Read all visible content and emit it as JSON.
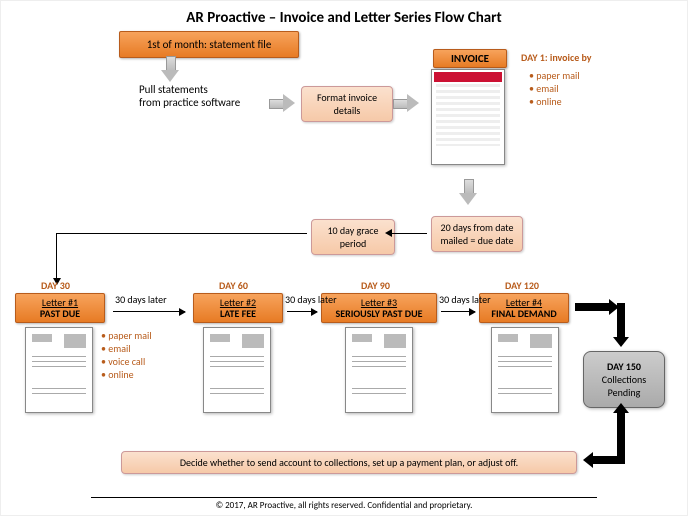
{
  "title": "AR Proactive – Invoice and Letter Series Flow Chart",
  "start_box": "1st of month: statement file",
  "pull_text": "Pull statements\nfrom practice software",
  "format_box": "Format invoice details",
  "invoice_header": "INVOICE",
  "day1_label": "DAY 1: invoice by",
  "day1_bullets": [
    "paper mail",
    "email",
    "online"
  ],
  "grace_box": "10 day grace period",
  "due_box": "20 days from date   mailed = due date",
  "inter_label": "30 days later",
  "letters": [
    {
      "day": "DAY 30",
      "l1": "Letter #1",
      "l2": "PAST DUE"
    },
    {
      "day": "DAY 60",
      "l1": "Letter #2",
      "l2": "LATE FEE"
    },
    {
      "day": "DAY 90",
      "l1": "Letter #3",
      "l2": "SERIOUSLY PAST DUE"
    },
    {
      "day": "DAY 120",
      "l1": "Letter #4",
      "l2": "FINAL DEMAND"
    }
  ],
  "letter_bullets": [
    "paper mail",
    "email",
    "voice call",
    "online"
  ],
  "collections": {
    "day": "DAY 150",
    "text": "Collections Pending"
  },
  "decide": "Decide whether to send account to collections, set up a payment plan, or adjust off.",
  "footer": "© 2017, AR Proactive, all rights reserved.  Confidential and proprietary."
}
